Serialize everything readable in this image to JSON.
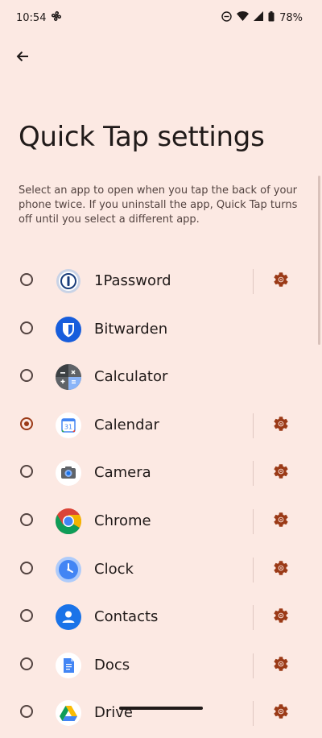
{
  "status_bar": {
    "time": "10:54",
    "battery": "78%"
  },
  "page": {
    "title": "Quick Tap settings",
    "description": "Select an app to open when you tap the back of your phone twice. If you uninstall the app, Quick Tap turns off until you select a different app."
  },
  "apps": [
    {
      "name": "1Password",
      "icon": "onepassword-icon",
      "selected": false,
      "has_settings": true
    },
    {
      "name": "Bitwarden",
      "icon": "bitwarden-icon",
      "selected": false,
      "has_settings": false
    },
    {
      "name": "Calculator",
      "icon": "calculator-icon",
      "selected": false,
      "has_settings": false
    },
    {
      "name": "Calendar",
      "icon": "calendar-icon",
      "selected": true,
      "has_settings": true
    },
    {
      "name": "Camera",
      "icon": "camera-icon",
      "selected": false,
      "has_settings": true
    },
    {
      "name": "Chrome",
      "icon": "chrome-icon",
      "selected": false,
      "has_settings": true
    },
    {
      "name": "Clock",
      "icon": "clock-icon",
      "selected": false,
      "has_settings": true
    },
    {
      "name": "Contacts",
      "icon": "contacts-icon",
      "selected": false,
      "has_settings": true
    },
    {
      "name": "Docs",
      "icon": "docs-icon",
      "selected": false,
      "has_settings": true
    },
    {
      "name": "Drive",
      "icon": "drive-icon",
      "selected": false,
      "has_settings": true
    }
  ],
  "colors": {
    "background": "#fce9e3",
    "accent": "#9b3a17"
  }
}
